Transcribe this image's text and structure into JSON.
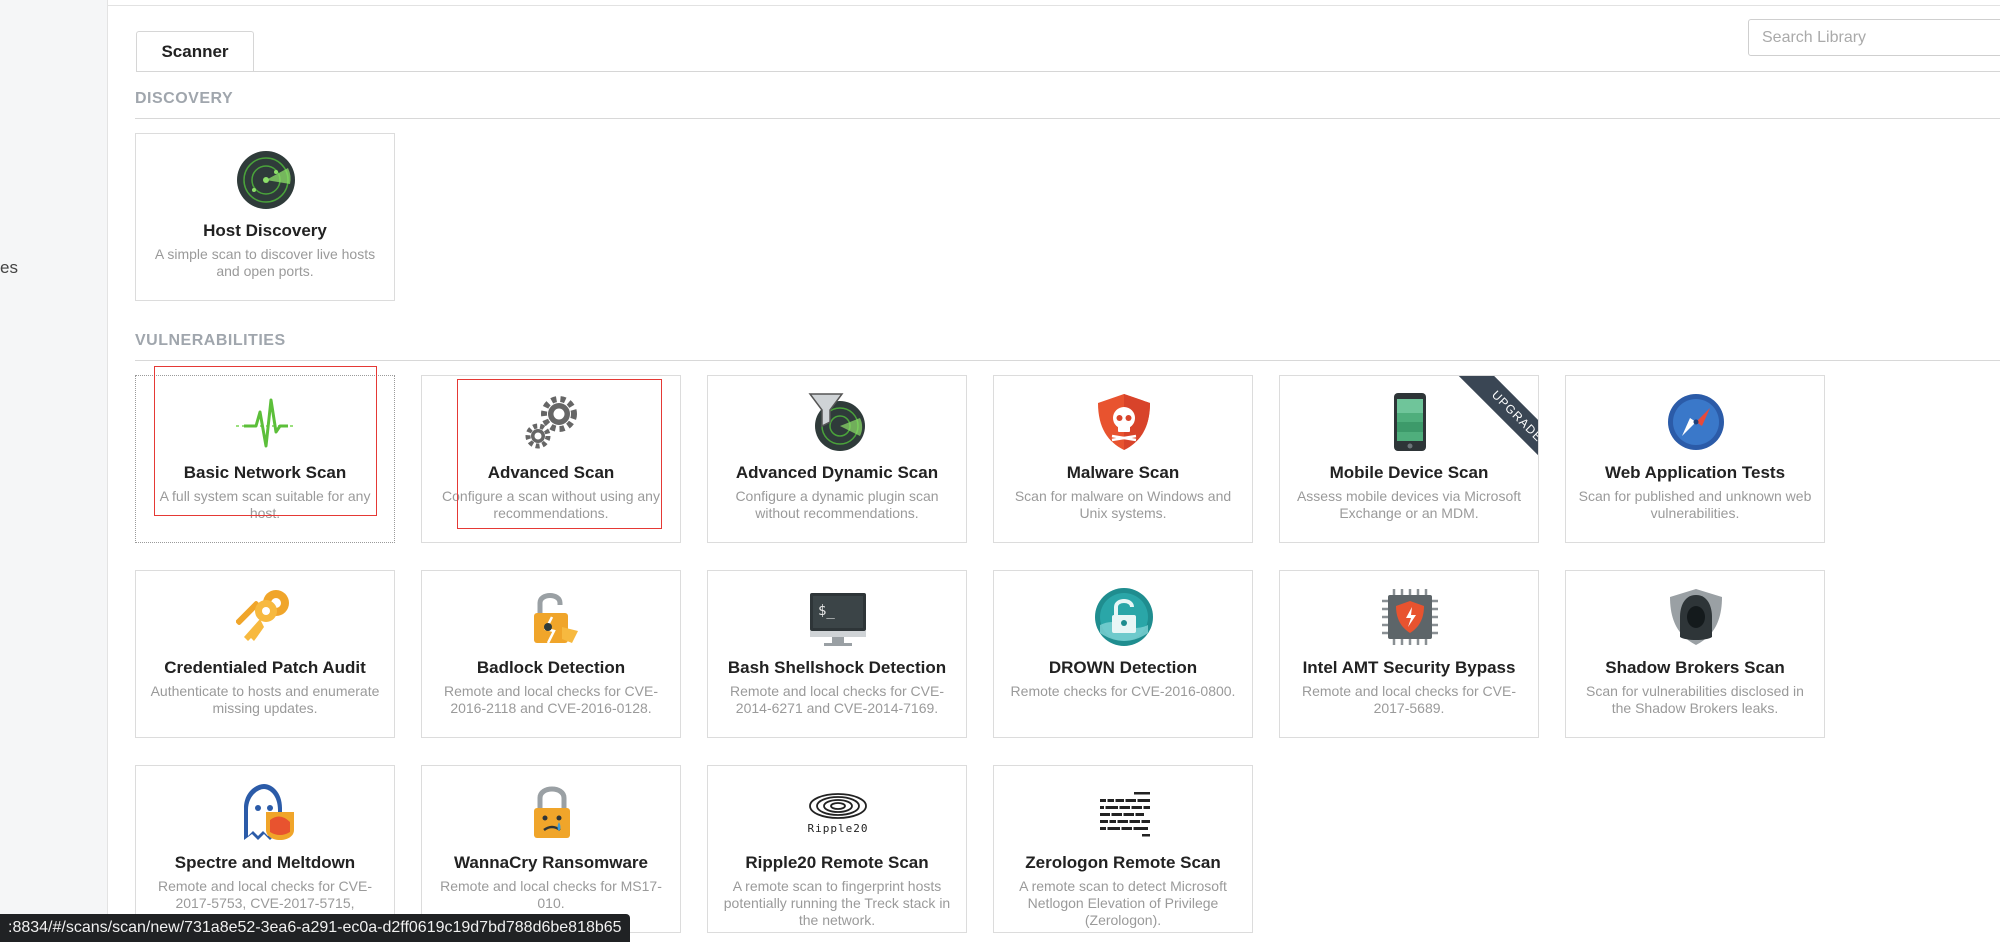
{
  "sidebar": {
    "fragment_text": "es"
  },
  "search": {
    "placeholder": "Search Library",
    "value": ""
  },
  "tabs": [
    {
      "label": "Scanner",
      "active": true
    }
  ],
  "sections": {
    "discovery": {
      "label": "DISCOVERY"
    },
    "vulnerabilities": {
      "label": "VULNERABILITIES"
    }
  },
  "cards": {
    "host_discovery": {
      "title": "Host Discovery",
      "desc": "A simple scan to discover live hosts and open ports.",
      "icon": "radar-icon"
    },
    "basic_network_scan": {
      "title": "Basic Network Scan",
      "desc": "A full system scan suitable for any host.",
      "icon": "pulse-icon"
    },
    "advanced_scan": {
      "title": "Advanced Scan",
      "desc": "Configure a scan without using any recommendations.",
      "icon": "gears-icon"
    },
    "advanced_dynamic_scan": {
      "title": "Advanced Dynamic Scan",
      "desc": "Configure a dynamic plugin scan without recommendations.",
      "icon": "radar-filter-icon"
    },
    "malware_scan": {
      "title": "Malware Scan",
      "desc": "Scan for malware on Windows and Unix systems.",
      "icon": "skull-shield-icon"
    },
    "mobile_device_scan": {
      "title": "Mobile Device Scan",
      "desc": "Assess mobile devices via Microsoft Exchange or an MDM.",
      "icon": "phone-icon",
      "badge": "UPGRADE"
    },
    "web_application_tests": {
      "title": "Web Application Tests",
      "desc": "Scan for published and unknown web vulnerabilities.",
      "icon": "compass-icon"
    },
    "credentialed_patch_audit": {
      "title": "Credentialed Patch Audit",
      "desc": "Authenticate to hosts and enumerate missing updates.",
      "icon": "keys-icon"
    },
    "badlock_detection": {
      "title": "Badlock Detection",
      "desc": "Remote and local checks for CVE-2016-2118 and CVE-2016-0128.",
      "icon": "broken-padlock-icon"
    },
    "bash_shellshock_detection": {
      "title": "Bash Shellshock Detection",
      "desc": "Remote and local checks for CVE-2014-6271 and CVE-2014-7169.",
      "icon": "terminal-monitor-icon",
      "prompt": "$_"
    },
    "drown_detection": {
      "title": "DROWN Detection",
      "desc": "Remote checks for CVE-2016-0800.",
      "icon": "drowning-lock-icon"
    },
    "intel_amt_security_bypass": {
      "title": "Intel AMT Security Bypass",
      "desc": "Remote and local checks for CVE-2017-5689.",
      "icon": "chip-shield-icon"
    },
    "shadow_brokers_scan": {
      "title": "Shadow Brokers Scan",
      "desc": "Scan for vulnerabilities disclosed in the Shadow Brokers leaks.",
      "icon": "hooded-figure-icon"
    },
    "spectre_and_meltdown": {
      "title": "Spectre and Meltdown",
      "desc": "Remote and local checks for CVE-2017-5753, CVE-2017-5715,",
      "icon": "ghost-icon"
    },
    "wannacry_ransomware": {
      "title": "WannaCry Ransomware",
      "desc": "Remote and local checks for MS17-010.",
      "icon": "crying-padlock-icon"
    },
    "ripple20_remote_scan": {
      "title": "Ripple20 Remote Scan",
      "desc": "A remote scan to fingerprint hosts potentially running the Treck stack in the network.",
      "icon": "ripple-icon",
      "logo_text": "Ripple20"
    },
    "zerologon_remote_scan": {
      "title": "Zerologon Remote Scan",
      "desc": "A remote scan to detect Microsoft Netlogon Elevation of Privilege (Zerologon).",
      "icon": "hex-dump-icon"
    }
  },
  "status_bar": {
    "text": ":8834/#/scans/scan/new/731a8e52-3ea6-a291-ec0a-d2ff0619c19d7bd788d6be818b65"
  },
  "colors": {
    "accent_red": "#e53935",
    "section_gray": "#a0a6ad",
    "radar_green": "#6fd34a"
  }
}
